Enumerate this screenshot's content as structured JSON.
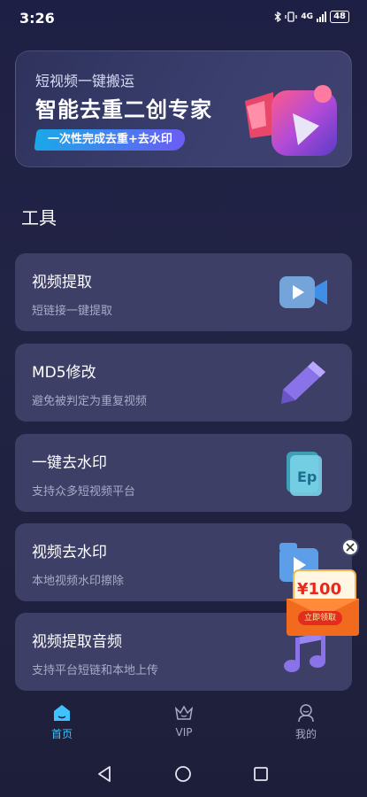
{
  "status_bar": {
    "time": "3:26",
    "network": "4G",
    "battery": "48"
  },
  "banner": {
    "kicker": "短视频一键搬运",
    "title": "智能去重二创专家",
    "pill": "一次性完成去重+去水印"
  },
  "section_title": "工具",
  "tools": [
    {
      "title": "视频提取",
      "subtitle": "短链接一键提取",
      "icon": "video-camera-icon"
    },
    {
      "title": "MD5修改",
      "subtitle": "避免被判定为重复视频",
      "icon": "pen-icon"
    },
    {
      "title": "一键去水印",
      "subtitle": "支持众多短视频平台",
      "icon": "watermark-remove-icon"
    },
    {
      "title": "视频去水印",
      "subtitle": "本地视频水印擦除",
      "icon": "folder-video-icon"
    },
    {
      "title": "视频提取音频",
      "subtitle": "支持平台短链和本地上传",
      "icon": "music-note-icon"
    }
  ],
  "promo": {
    "amount": "¥100",
    "button": "立即领取"
  },
  "tab_bar": {
    "items": [
      {
        "label": "首页",
        "active": true,
        "icon": "home-icon"
      },
      {
        "label": "VIP",
        "active": false,
        "icon": "crown-icon"
      },
      {
        "label": "我的",
        "active": false,
        "icon": "profile-icon"
      }
    ]
  },
  "colors": {
    "accent": "#3ec3ff",
    "card_bg": "#3d3f66",
    "page_bg": "#1f2143",
    "promo_red": "#e42c1e"
  }
}
